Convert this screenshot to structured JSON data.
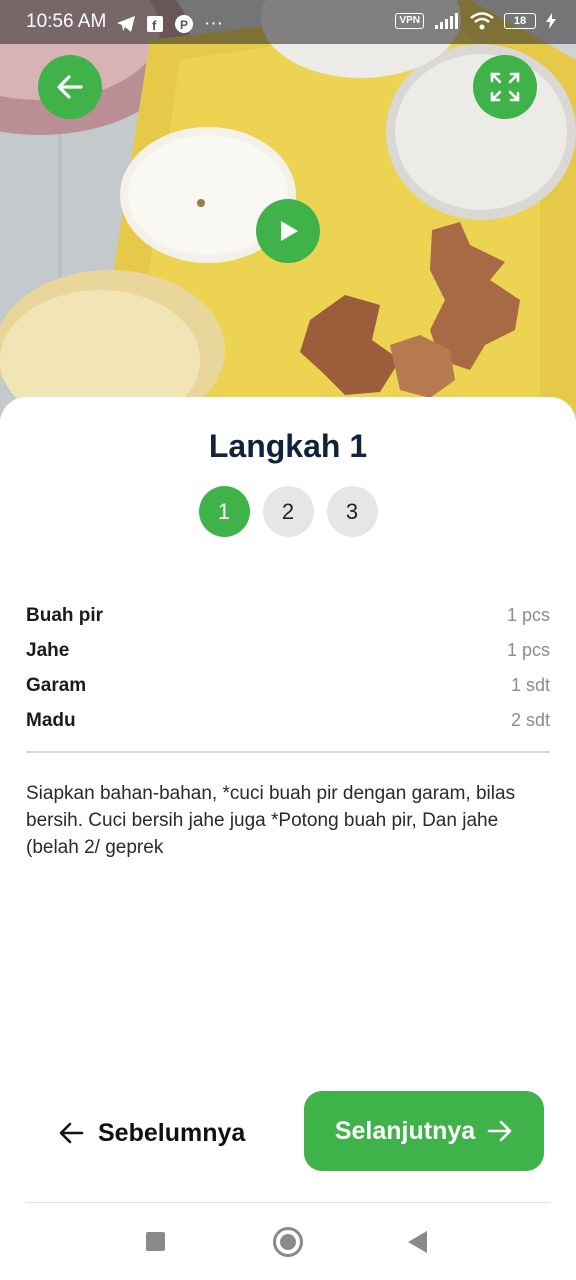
{
  "status_bar": {
    "time": "10:56 AM",
    "dots": "···",
    "vpn": "VPN",
    "battery": "18"
  },
  "hero": {
    "icons": [
      "arrow-left-icon",
      "fullscreen-icon",
      "play-icon"
    ]
  },
  "step": {
    "title": "Langkah 1",
    "numbers": [
      "1",
      "2",
      "3"
    ],
    "active": "1"
  },
  "ingredients": [
    {
      "name": "Buah pir",
      "qty": "1 pcs"
    },
    {
      "name": "Jahe",
      "qty": "1 pcs"
    },
    {
      "name": "Garam",
      "qty": "1 sdt"
    },
    {
      "name": "Madu",
      "qty": "2 sdt"
    }
  ],
  "description": "Siapkan bahan-bahan, *cuci buah pir dengan garam, bilas bersih. Cuci bersih jahe juga *Potong buah pir, Dan jahe (belah 2/ geprek",
  "navigation": {
    "prev_label": "Sebelumnya",
    "next_label": "Selanjutnya"
  },
  "colors": {
    "accent": "#3fb24a",
    "title": "#10233d",
    "step_inactive": "#e6e6e6"
  }
}
